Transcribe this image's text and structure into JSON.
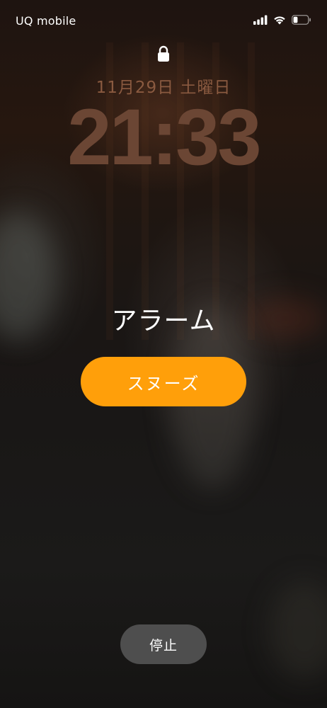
{
  "status_bar": {
    "carrier": "UQ mobile",
    "signal_icon": "cellular-signal-icon",
    "wifi_icon": "wifi-icon",
    "battery_icon": "battery-icon",
    "battery_level": 0.3
  },
  "lock_screen": {
    "lock_icon": "lock-icon",
    "date": "11月29日 土曜日",
    "time": "21:33"
  },
  "alarm": {
    "title": "アラーム",
    "snooze_label": "スヌーズ",
    "stop_label": "停止"
  },
  "colors": {
    "snooze_button": "#ff9f0a",
    "stop_button": "#585858",
    "clock_text": "#6b4634"
  }
}
